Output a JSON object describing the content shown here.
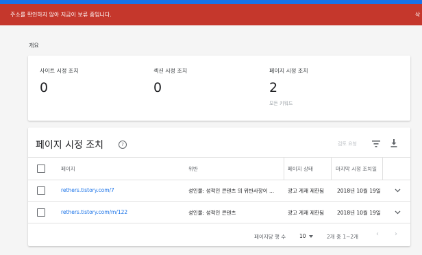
{
  "alert": {
    "message": "주소를 확인하지 않아 지금이 보류 중입니다.",
    "action": "삭"
  },
  "overview": {
    "label": "개요",
    "stats": [
      {
        "label": "사이트 시정 조치",
        "value": "0",
        "sub": ""
      },
      {
        "label": "섹션 시정 조치",
        "value": "0",
        "sub": ""
      },
      {
        "label": "페이지 시정 조치",
        "value": "2",
        "sub": "모든 키워드"
      }
    ]
  },
  "table": {
    "title": "페이지 시정 조치",
    "help_icon": "help-circle-icon",
    "review_label": "검토 요청",
    "columns": [
      "페이지",
      "위반",
      "페이지 상태",
      "마지막 시정 조치일"
    ],
    "rows": [
      {
        "page": "rethers.tistory.com/7",
        "violation": "성인물: 성적인 콘텐츠 의 위반사항이 ...",
        "status": "광고 게재 제한됨",
        "date": "2018년 10월 19일"
      },
      {
        "page": "rethers.tistory.com/m/122",
        "violation": "성인물: 성적인 콘텐츠",
        "status": "광고 게재 제한됨",
        "date": "2018년 10월 19일"
      }
    ],
    "footer": {
      "rows_per_page_label": "페이지당 행 수",
      "rows_per_page_value": "10",
      "range_text": "2개 중 1~2개",
      "prev": "‹",
      "next": "›"
    }
  },
  "colors": {
    "alert_bg": "#c5372c",
    "top_strip": "#1a73e8",
    "link": "#1a73e8"
  }
}
